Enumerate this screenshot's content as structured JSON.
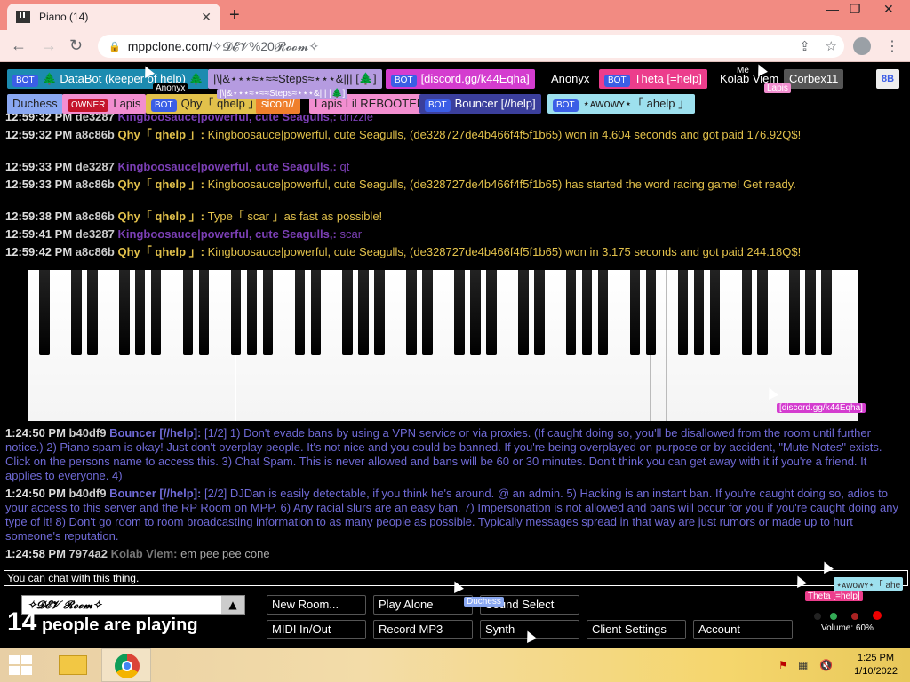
{
  "browser": {
    "tab_title": "Piano (14)",
    "url_host": "mppclone.com/",
    "url_path": "✧𝓓𝓔𝓥%20𝓡𝓸𝓸𝓶✧"
  },
  "userlist": [
    {
      "badge": "BOT",
      "name": "🌲 DataBot (keeper of help) 🌲",
      "color": "#1c8bb0"
    },
    {
      "badge": "",
      "name": "|\\|&⋆⋆⋆≈⋆≈≈Steps≈⋆⋆⋆&||| [🌲]",
      "color": "#b59be0"
    },
    {
      "badge": "BOT",
      "name": "[discord.gg/k44Eqha]",
      "color": "#d43ccf"
    },
    {
      "badge": "",
      "name": "Anonyx",
      "color": "#000000"
    },
    {
      "badge": "BOT",
      "name": "Theta [=help]",
      "color": "#ec3d8c"
    },
    {
      "badge": "",
      "name": "Kolab Viem",
      "color": "#000000"
    },
    {
      "badge": "",
      "name": "Corbex11",
      "color": "#555555"
    },
    {
      "badge": "",
      "name": "Duchess",
      "color": "#8aa8f2"
    },
    {
      "badge": "OWNER",
      "name": "Lapis",
      "color": "#f28ed0"
    },
    {
      "badge": "BOT",
      "name": "Qhy「 qhelp 」",
      "color": "#e2c14b"
    },
    {
      "badge": "",
      "name": "sicon//",
      "color": "#ef7f2c"
    },
    {
      "badge": "",
      "name": "Lapis Lil REBOOTED",
      "color": "#f28ed0"
    },
    {
      "badge": "BOT",
      "name": "Bouncer [//help]",
      "color": "#3b3f9c"
    },
    {
      "badge": "BOT",
      "name": "⋆ᴀᴡᴏᴡʏ⋆「 ahelp 」",
      "color": "#9de0ee"
    }
  ],
  "menu_button": "8B",
  "messages_top": [
    {
      "time": "12:59:32 PM",
      "id": "de3287",
      "name": "Kingboosauce|powerful, cute Seagulls,:",
      "style": "k",
      "text": "drizzle"
    },
    {
      "time": "12:59:32 PM",
      "id": "a8c86b",
      "name": "Qhy「 qhelp 」:",
      "style": "q",
      "text": "Kingboosauce|powerful, cute Seagulls, (de328727de4b466f4f5f1b65) won in 4.604 seconds and got paid 176.92Q$!"
    },
    {
      "time": "12:59:33 PM",
      "id": "de3287",
      "name": "Kingboosauce|powerful, cute Seagulls,:",
      "style": "k",
      "text": "qt"
    },
    {
      "time": "12:59:33 PM",
      "id": "a8c86b",
      "name": "Qhy「 qhelp 」:",
      "style": "q",
      "text": "Kingboosauce|powerful, cute Seagulls, (de328727de4b466f4f5f1b65) has started the word racing game! Get ready."
    },
    {
      "time": "12:59:38 PM",
      "id": "a8c86b",
      "name": "Qhy「 qhelp 」:",
      "style": "q",
      "text": "Type「 scar 」as fast as possible!"
    },
    {
      "time": "12:59:41 PM",
      "id": "de3287",
      "name": "Kingboosauce|powerful, cute Seagulls,:",
      "style": "k",
      "text": "scar"
    },
    {
      "time": "12:59:42 PM",
      "id": "a8c86b",
      "name": "Qhy「 qhelp 」:",
      "style": "q",
      "text": "Kingboosauce|powerful, cute Seagulls, (de328727de4b466f4f5f1b65) won in 3.175 seconds and got paid 244.18Q$!"
    }
  ],
  "messages_bottom": [
    {
      "time": "1:24:50 PM",
      "id": "b40df9",
      "name": "Bouncer [//help]:",
      "style": "b",
      "text": "[1/2] 1) Don't evade bans by using a VPN service or via proxies. (If caught doing so, you'll be disallowed from the room until further notice.) 2) Piano spam is okay! Just don't overplay people. It's not nice and you could be banned. If you're being overplayed on purpose or by accident, \"Mute Notes\" exists. Click on the persons name to access this. 3) Chat Spam. This is never allowed and bans will be 60 or 30 minutes. Don't think you can get away with it if you're a friend. It applies to everyone. 4)"
    },
    {
      "time": "1:24:50 PM",
      "id": "b40df9",
      "name": "Bouncer [//help]:",
      "style": "b",
      "text": "[2/2] DJDan is easily detectable, if you think he's around. @ an admin. 5) Hacking is an instant ban. If you're caught doing so, adios to your access to this server and the RP Room on MPP. 6) Any racial slurs are an easy ban. 7) Impersonation is not allowed and bans will occur for you if you're caught doing any type of it! 8) Don't go room to room broadcasting information to as many people as possible. Typically messages spread in that way are just rumors or made up to hurt someone's reputation."
    },
    {
      "time": "1:24:58 PM",
      "id": "7974a2",
      "name": "Kolab Viem:",
      "style": "kv",
      "text": "em pee pee cone"
    }
  ],
  "chat_placeholder": "You can chat with this thing.",
  "room_name": "✧𝓓𝓔𝓥 𝓡𝓸𝓸𝓶✧",
  "player_count": "14",
  "player_count_suffix": "people are playing",
  "controls": [
    "New Room...",
    "Play Alone",
    "Sound Select",
    "MIDI In/Out",
    "Record MP3",
    "Synth",
    "Client Settings",
    "Account"
  ],
  "volume_text": "Volume: 60%",
  "cursor_labels": {
    "anonyx": "Anonyx",
    "me": "Me",
    "lapis": "Lapis",
    "discord": "[discord.gg/k44Eqha]",
    "duchess": "Duchess",
    "awowy": "⋆ᴀᴡᴏᴡʏ⋆「 ahe",
    "theta": "Theta [=help]",
    "steps": "|\\|&⋆⋆⋆≈⋆≈≈Steps≈⋆⋆⋆&||| [🌲]"
  },
  "taskbar": {
    "time": "1:25 PM",
    "date": "1/10/2022"
  }
}
